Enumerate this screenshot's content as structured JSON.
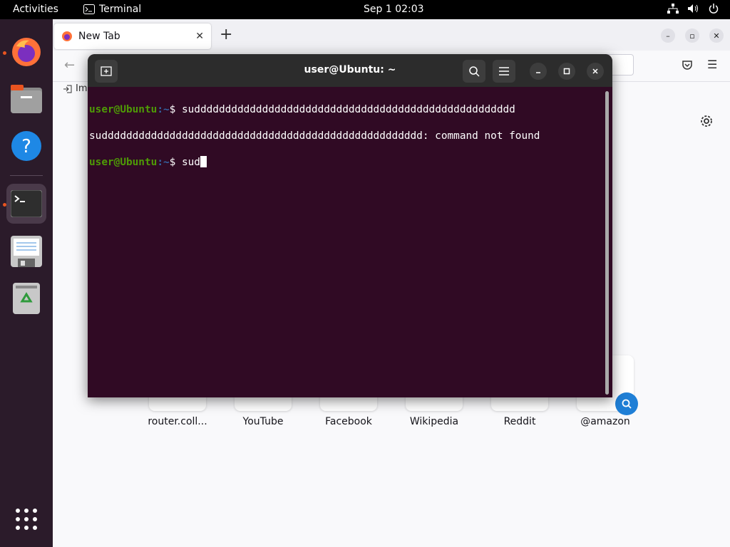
{
  "topbar": {
    "activities": "Activities",
    "app_name": "Terminal",
    "clock": "Sep 1  02:03"
  },
  "dock": {
    "items": [
      {
        "name": "Firefox"
      },
      {
        "name": "Files"
      },
      {
        "name": "Help"
      },
      {
        "name": "Terminal"
      },
      {
        "name": "Text Editor"
      },
      {
        "name": "Trash"
      }
    ]
  },
  "firefox": {
    "tab_title": "New Tab",
    "bookmark_label": "Im",
    "shortcuts": [
      {
        "label": "router.coll..."
      },
      {
        "label": "YouTube"
      },
      {
        "label": "Facebook"
      },
      {
        "label": "Wikipedia"
      },
      {
        "label": "Reddit"
      },
      {
        "label": "@amazon"
      }
    ]
  },
  "terminal": {
    "title": "user@Ubuntu: ~",
    "lines": [
      {
        "user": "user@Ubuntu",
        "path": ":~",
        "prompt": "$ ",
        "text": "sudddddddddddddddddddddddddddddddddddddddddddddddddddd"
      },
      {
        "output": "sudddddddddddddddddddddddddddddddddddddddddddddddddddd: command not found"
      },
      {
        "user": "user@Ubuntu",
        "path": ":~",
        "prompt": "$ ",
        "text": "sud"
      }
    ]
  },
  "colors": {
    "terminal_bg": "#300a24",
    "prompt_user": "#4e9a06",
    "prompt_path": "#3465a4",
    "accent": "#e95420"
  }
}
